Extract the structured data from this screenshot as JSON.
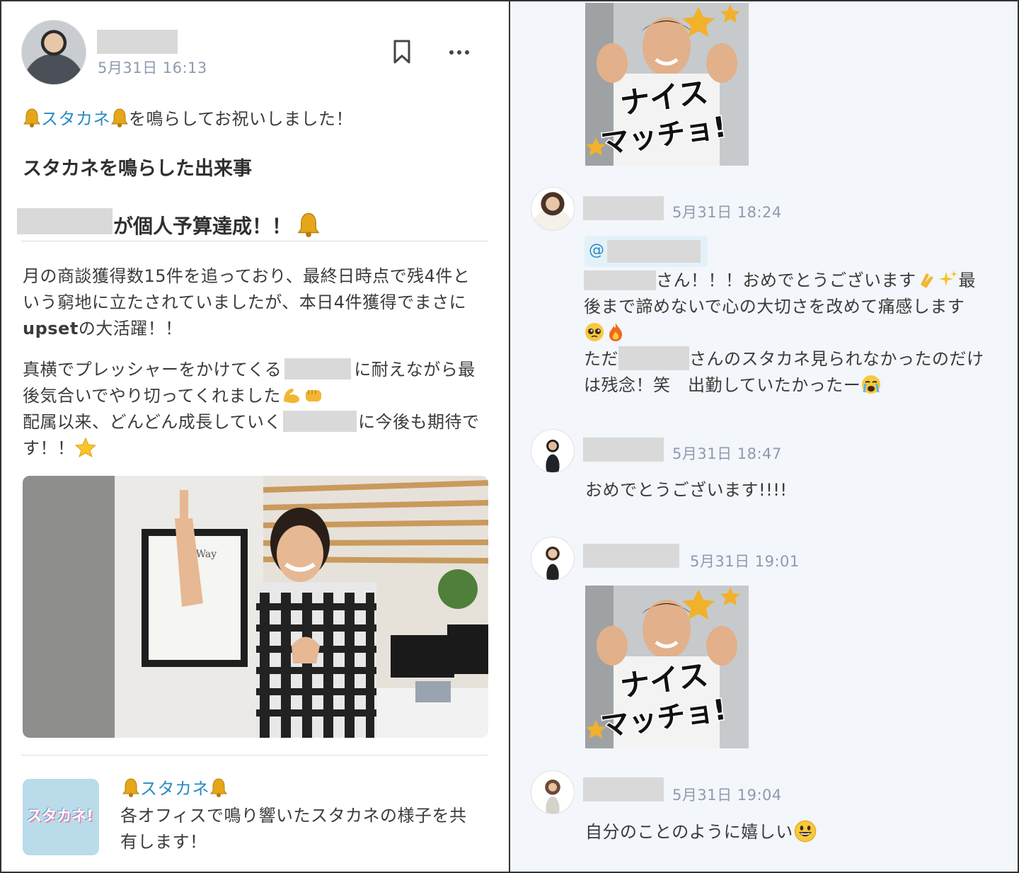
{
  "post": {
    "timestamp": "5月31日 16:13",
    "action": {
      "channel": "スタカネ",
      "suffix": "を鳴らしてお祝いしました！"
    },
    "section_title": "スタカネを鳴らした出来事",
    "headline": "が個人予算達成！！",
    "body1": [
      "月の商談獲得数15件を追っており、最終日時点で残4件と",
      "いう窮地に立たされていましたが、本日4件獲得でまさに"
    ],
    "body1_bold": "upset",
    "body1_tail": "の大活躍！！",
    "body2_line1_a": "真横でプレッシャーをかけてくる",
    "body2_line1_b": "に耐えながら最",
    "body2_line2": "後気合いでやり切ってくれました",
    "body2_line3_a": "配属以来、どんどん成長していく",
    "body2_line3_b": "に今後も期待で",
    "body2_line4": "す！！",
    "poster_text": "e Way"
  },
  "channel_card": {
    "name": "スタカネ",
    "thumb_label": "スタカネ!",
    "description": [
      "各オフィスで鳴り響いたスタカネの様子を共",
      "有します！"
    ]
  },
  "sticker": {
    "line1": "ナイス",
    "line2": "マッチョ!"
  },
  "comments": [
    {
      "timestamp": "5月31日 18:24",
      "mention": "@",
      "line1_a": "さん！！！おめでとうございます",
      "line1_b": "最",
      "line2": "後まで諦めないで心の大切さを改めて痛感します",
      "line4_a": "ただ",
      "line4_b": "さんのスタカネ見られなかったのだけ",
      "line5": "は残念！笑　出勤していたかったー"
    },
    {
      "timestamp": "5月31日 18:47",
      "text": "おめでとうございます!!!!"
    },
    {
      "timestamp": "5月31日 19:01"
    },
    {
      "timestamp": "5月31日 19:04",
      "text": "自分のことのように嬉しい"
    }
  ],
  "colors": {
    "link": "#2a8bc4",
    "timestamp": "#8e9ab0",
    "right_bg": "#f3f6fa",
    "redaction": "#d9d9d9"
  }
}
